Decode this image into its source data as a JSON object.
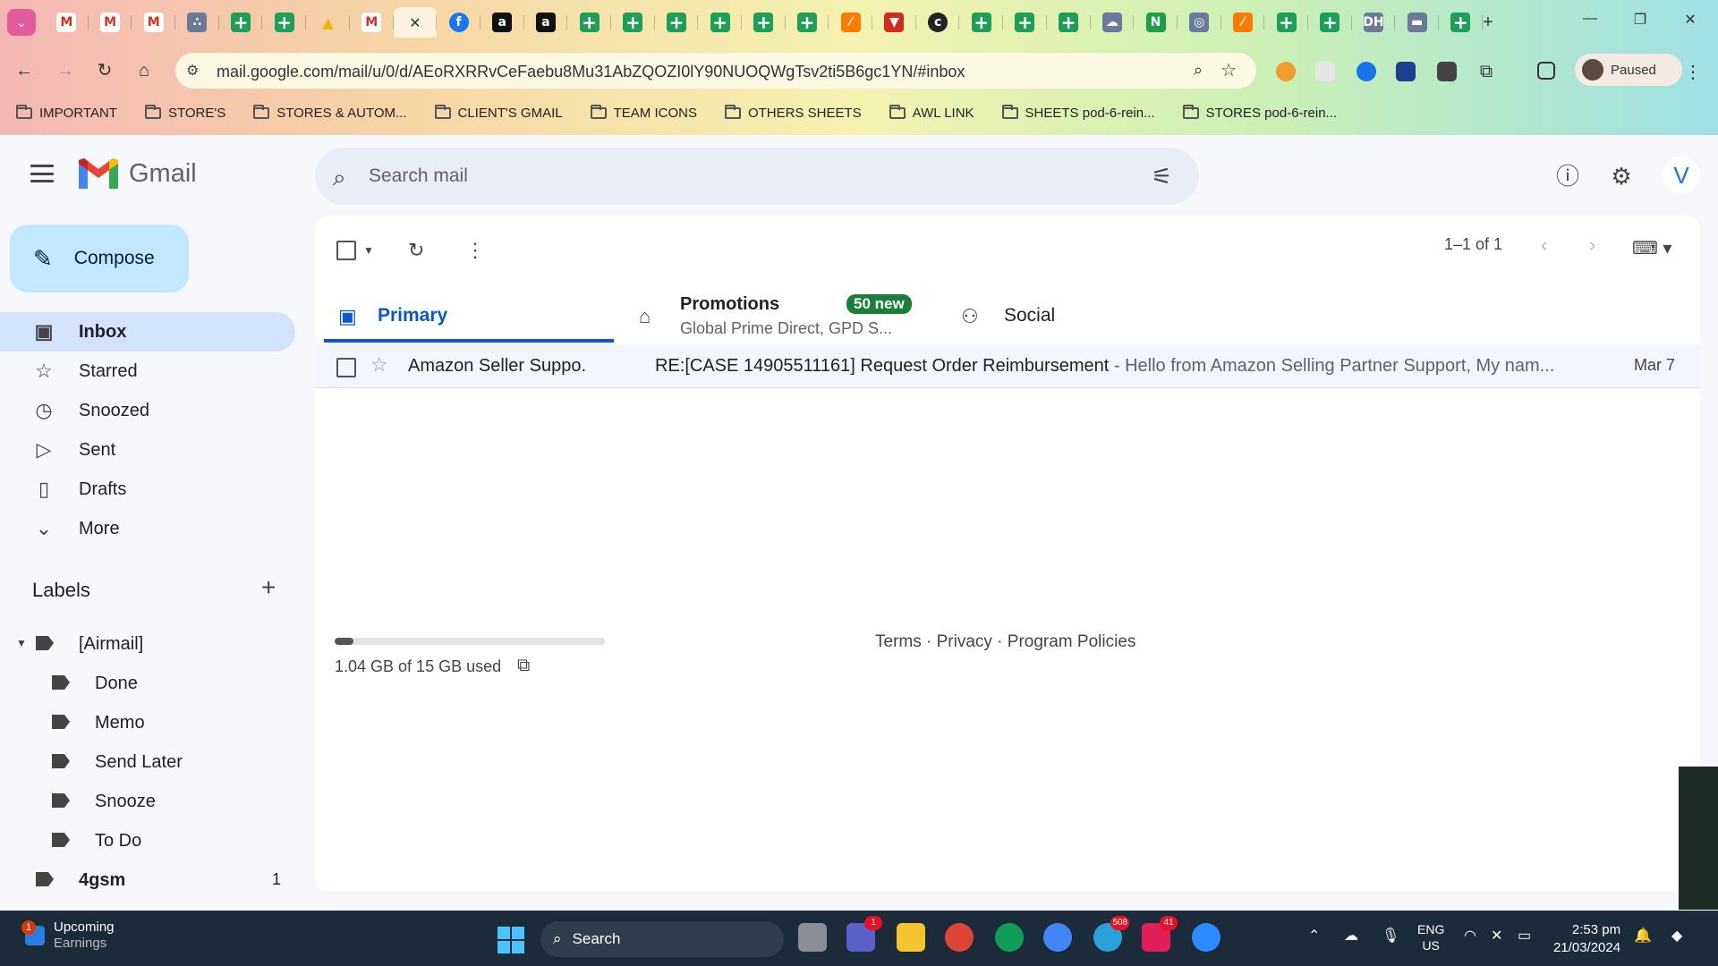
{
  "browser": {
    "url": "mail.google.com/mail/u/0/d/AEoRXRRvCeFaebu8Mu31AbZQOZI0lY90NUOQWgTsv2ti5B6gc1YN/#inbox",
    "profile_label": "Paused",
    "tabs": [
      {
        "icon": "gmail-icon",
        "glyph": "M",
        "kind": "gmail"
      },
      {
        "icon": "gmail-icon",
        "glyph": "M",
        "kind": "gmail"
      },
      {
        "icon": "gmail-icon",
        "glyph": "M",
        "kind": "gmail"
      },
      {
        "icon": "asana-icon",
        "glyph": "∴",
        "kind": "generic"
      },
      {
        "icon": "sheets-icon",
        "glyph": "",
        "kind": "sheets"
      },
      {
        "icon": "sheets-icon",
        "glyph": "",
        "kind": "sheets"
      },
      {
        "icon": "drive-icon",
        "glyph": "▲",
        "kind": "drive"
      },
      {
        "icon": "gmail-icon",
        "glyph": "M",
        "kind": "gmail"
      },
      {
        "icon": "close-icon",
        "glyph": "✕",
        "kind": "active"
      },
      {
        "icon": "facebook-icon",
        "glyph": "f",
        "kind": "fb"
      },
      {
        "icon": "amazon-icon",
        "glyph": "a",
        "kind": "amazon"
      },
      {
        "icon": "amazon-icon",
        "glyph": "a",
        "kind": "amazon"
      },
      {
        "icon": "sheets-icon",
        "glyph": "",
        "kind": "sheets"
      },
      {
        "icon": "sheets-icon",
        "glyph": "",
        "kind": "sheets"
      },
      {
        "icon": "sheets-icon",
        "glyph": "",
        "kind": "sheets"
      },
      {
        "icon": "sheets-icon",
        "glyph": "",
        "kind": "sheets"
      },
      {
        "icon": "sheets-icon",
        "glyph": "",
        "kind": "sheets"
      },
      {
        "icon": "sheets-icon",
        "glyph": "",
        "kind": "sheets"
      },
      {
        "icon": "slash-icon",
        "glyph": "⁄",
        "kind": "orange"
      },
      {
        "icon": "filter-icon",
        "glyph": "▼",
        "kind": "red"
      },
      {
        "icon": "circle-c-icon",
        "glyph": "c",
        "kind": "round"
      },
      {
        "icon": "sheets-icon",
        "glyph": "",
        "kind": "sheets"
      },
      {
        "icon": "sheets-icon",
        "glyph": "",
        "kind": "sheets"
      },
      {
        "icon": "sheets-icon",
        "glyph": "",
        "kind": "sheets"
      },
      {
        "icon": "cloud-icon",
        "glyph": "☁",
        "kind": "generic"
      },
      {
        "icon": "n-logo-icon",
        "glyph": "N",
        "kind": "green2"
      },
      {
        "icon": "circle-logo-icon",
        "glyph": "◎",
        "kind": "generic"
      },
      {
        "icon": "slash-icon",
        "glyph": "⁄",
        "kind": "orange"
      },
      {
        "icon": "sheets-icon",
        "glyph": "",
        "kind": "sheets"
      },
      {
        "icon": "sheets-icon",
        "glyph": "",
        "kind": "sheets"
      },
      {
        "icon": "dh-icon",
        "glyph": "DH",
        "kind": "generic"
      },
      {
        "icon": "window-icon",
        "glyph": "▬",
        "kind": "generic"
      },
      {
        "icon": "sheets-icon",
        "glyph": "",
        "kind": "sheets"
      }
    ],
    "bookmarks": [
      "IMPORTANT",
      "STORE'S",
      "STORES & AUTOM...",
      "CLIENT'S GMAIL",
      "TEAM ICONS",
      "OTHERS SHEETS",
      "AWL LINK",
      "SHEETS pod-6-rein...",
      "STORES pod-6-rein..."
    ]
  },
  "gmail": {
    "logo_text": "Gmail",
    "search_placeholder": "Search mail",
    "compose_label": "Compose",
    "nav": [
      {
        "label": "Inbox",
        "icon": "inbox-icon",
        "glyph": "▣",
        "active": true
      },
      {
        "label": "Starred",
        "icon": "star-icon",
        "glyph": "☆",
        "active": false
      },
      {
        "label": "Snoozed",
        "icon": "clock-icon",
        "glyph": "◷",
        "active": false
      },
      {
        "label": "Sent",
        "icon": "send-icon",
        "glyph": "▷",
        "active": false
      },
      {
        "label": "Drafts",
        "icon": "draft-icon",
        "glyph": "▯",
        "active": false
      },
      {
        "label": "More",
        "icon": "chevron-down-icon",
        "glyph": "⌄",
        "active": false
      }
    ],
    "labels_heading": "Labels",
    "labels": [
      {
        "name": "[Airmail]",
        "indent": 0,
        "caret": true,
        "count": ""
      },
      {
        "name": "Done",
        "indent": 1,
        "caret": false,
        "count": ""
      },
      {
        "name": "Memo",
        "indent": 1,
        "caret": false,
        "count": ""
      },
      {
        "name": "Send Later",
        "indent": 1,
        "caret": false,
        "count": ""
      },
      {
        "name": "Snooze",
        "indent": 1,
        "caret": false,
        "count": ""
      },
      {
        "name": "To Do",
        "indent": 1,
        "caret": false,
        "count": ""
      },
      {
        "name": "4gsm",
        "indent": 0,
        "caret": false,
        "count": "1",
        "bold": true
      }
    ],
    "pagination": "1–1 of 1",
    "tabs": {
      "primary": "Primary",
      "promotions": "Promotions",
      "promotions_badge": "50 new",
      "promotions_sub": "Global Prime Direct, GPD S...",
      "social": "Social"
    },
    "emails": [
      {
        "sender": "Amazon Seller Suppo.",
        "subject": "RE:[CASE 14905511161] Request Order Reimbursement",
        "snippet": " - Hello from Amazon Selling Partner Support, My nam...",
        "date": "Mar 7"
      }
    ],
    "storage": {
      "text": "1.04 GB of 15 GB used",
      "used_fraction": 0.069
    },
    "footer": "Terms · Privacy · Program Policies",
    "account_initial": "V"
  },
  "taskbar": {
    "widget_title": "Upcoming",
    "widget_sub": "Earnings",
    "widget_badge": "1",
    "search_label": "Search",
    "teams_badge": "1",
    "telegram_badge": "508",
    "slack_badge": "41",
    "lang_top": "ENG",
    "lang_bottom": "US",
    "time": "2:53 pm",
    "date": "21/03/2024"
  },
  "colors": {
    "accent": "#0b57d0",
    "compose": "#c2e7ff",
    "active_nav": "#d3e3fd",
    "badge_green": "#188038"
  }
}
